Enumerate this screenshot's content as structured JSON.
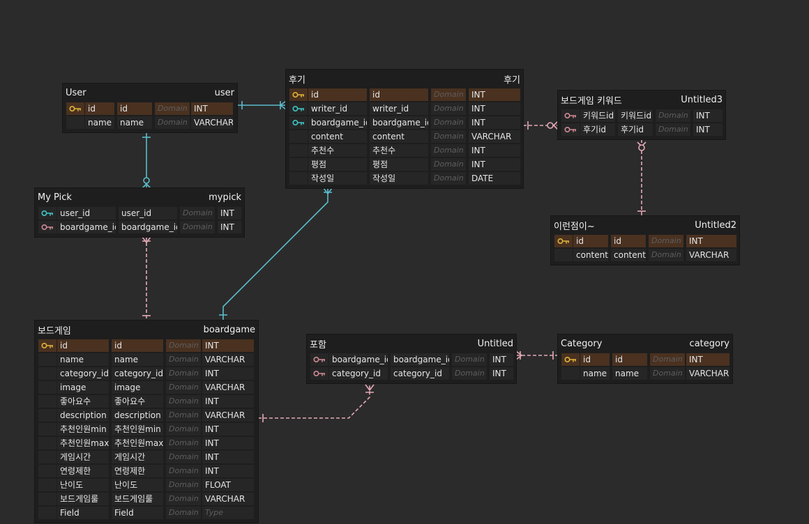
{
  "colors": {
    "background": "#2b2b2b",
    "pk_row": "#4a3120",
    "pk_key": "#e0b33a",
    "fk_key": "#3ec6c6",
    "ref_key": "#d08a96",
    "teal_line": "#5bbccb",
    "pink_line": "#e6a9b6"
  },
  "entities": [
    {
      "id": "user",
      "title": "User",
      "name": "user",
      "rows": [
        {
          "k": "pk",
          "f": "id",
          "c": "id",
          "d": "Domain",
          "t": "INT"
        },
        {
          "k": "",
          "f": "name",
          "c": "name",
          "d": "Domain",
          "t": "VARCHAR"
        }
      ]
    },
    {
      "id": "review",
      "title": "후기",
      "name": "후기",
      "rows": [
        {
          "k": "pk",
          "f": "id",
          "c": "id",
          "d": "Domain",
          "t": "INT"
        },
        {
          "k": "fk",
          "f": "writer_id",
          "c": "writer_id",
          "d": "Domain",
          "t": "INT"
        },
        {
          "k": "fk",
          "f": "boardgame_id",
          "c": "boardgame_id",
          "d": "Domain",
          "t": "INT"
        },
        {
          "k": "",
          "f": "content",
          "c": "content",
          "d": "Domain",
          "t": "VARCHAR"
        },
        {
          "k": "",
          "f": "추천수",
          "c": "추천수",
          "d": "Domain",
          "t": "INT"
        },
        {
          "k": "",
          "f": "평점",
          "c": "평점",
          "d": "Domain",
          "t": "INT"
        },
        {
          "k": "",
          "f": "작성일",
          "c": "작성일",
          "d": "Domain",
          "t": "DATE"
        }
      ]
    },
    {
      "id": "keyword",
      "title": "보드게임 키워드",
      "name": "Untitled3",
      "rows": [
        {
          "k": "ref",
          "f": "키워드id",
          "c": "키워드id",
          "d": "Domain",
          "t": "INT"
        },
        {
          "k": "ref",
          "f": "후기id",
          "c": "후기id",
          "d": "Domain",
          "t": "INT"
        }
      ]
    },
    {
      "id": "mypick",
      "title": "My Pick",
      "name": "mypick",
      "rows": [
        {
          "k": "fk",
          "f": "user_id",
          "c": "user_id",
          "d": "Domain",
          "t": "INT"
        },
        {
          "k": "ref",
          "f": "boardgame_id",
          "c": "boardgame_id",
          "d": "Domain",
          "t": "INT"
        }
      ]
    },
    {
      "id": "untitled2",
      "title": "이런점이~",
      "name": "Untitled2",
      "rows": [
        {
          "k": "pk",
          "f": "id",
          "c": "id",
          "d": "Domain",
          "t": "INT"
        },
        {
          "k": "",
          "f": "content",
          "c": "content",
          "d": "Domain",
          "t": "VARCHAR"
        }
      ]
    },
    {
      "id": "boardgame",
      "title": "보드게임",
      "name": "boardgame",
      "rows": [
        {
          "k": "pk",
          "f": "id",
          "c": "id",
          "d": "Domain",
          "t": "INT"
        },
        {
          "k": "",
          "f": "name",
          "c": "name",
          "d": "Domain",
          "t": "VARCHAR"
        },
        {
          "k": "",
          "f": "category_id",
          "c": "category_id",
          "d": "Domain",
          "t": "INT"
        },
        {
          "k": "",
          "f": "image",
          "c": "image",
          "d": "Domain",
          "t": "VARCHAR"
        },
        {
          "k": "",
          "f": "좋아요수",
          "c": "좋아요수",
          "d": "Domain",
          "t": "INT"
        },
        {
          "k": "",
          "f": "description",
          "c": "description",
          "d": "Domain",
          "t": "VARCHAR"
        },
        {
          "k": "",
          "f": "추천인원min",
          "c": "추천인원min",
          "d": "Domain",
          "t": "INT"
        },
        {
          "k": "",
          "f": "추천인원max",
          "c": "추천인원max",
          "d": "Domain",
          "t": "INT"
        },
        {
          "k": "",
          "f": "게임시간",
          "c": "게임시간",
          "d": "Domain",
          "t": "INT"
        },
        {
          "k": "",
          "f": "연령제한",
          "c": "연령제한",
          "d": "Domain",
          "t": "INT"
        },
        {
          "k": "",
          "f": "난이도",
          "c": "난이도",
          "d": "Domain",
          "t": "FLOAT"
        },
        {
          "k": "",
          "f": "보드게임룰",
          "c": "보드게임룰",
          "d": "Domain",
          "t": "VARCHAR"
        },
        {
          "k": "",
          "f": "Field",
          "c": "Field",
          "d": "Domain",
          "t": "Type",
          "placeholder": true
        }
      ]
    },
    {
      "id": "includes",
      "title": "포함",
      "name": "Untitled",
      "rows": [
        {
          "k": "ref",
          "f": "boardgame_id",
          "c": "boardgame_id",
          "d": "Domain",
          "t": "INT"
        },
        {
          "k": "ref",
          "f": "category_id",
          "c": "category_id",
          "d": "Domain",
          "t": "INT"
        }
      ]
    },
    {
      "id": "category",
      "title": "Category",
      "name": "category",
      "rows": [
        {
          "k": "pk",
          "f": "id",
          "c": "id",
          "d": "Domain",
          "t": "INT"
        },
        {
          "k": "",
          "f": "name",
          "c": "name",
          "d": "Domain",
          "t": "VARCHAR"
        }
      ]
    }
  ]
}
